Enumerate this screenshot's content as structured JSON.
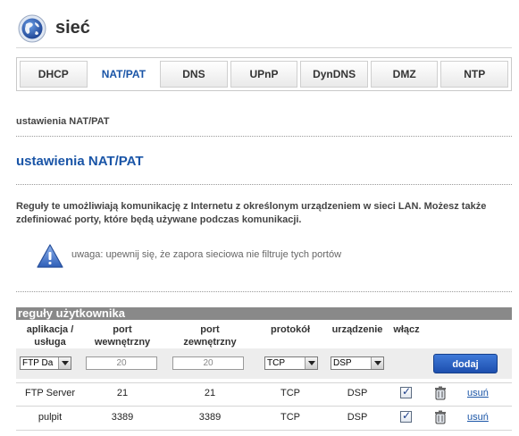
{
  "app": {
    "title": "sieć",
    "icon": "globe-icon"
  },
  "tabs": [
    {
      "label": "DHCP",
      "active": false
    },
    {
      "label": "NAT/PAT",
      "active": true
    },
    {
      "label": "DNS",
      "active": false
    },
    {
      "label": "UPnP",
      "active": false
    },
    {
      "label": "DynDNS",
      "active": false
    },
    {
      "label": "DMZ",
      "active": false
    },
    {
      "label": "NTP",
      "active": false
    }
  ],
  "breadcrumb": "ustawienia NAT/PAT",
  "page_title": "ustawienia NAT/PAT",
  "description": "Reguły te umożliwiają komunikację z Internetu z określonym urządzeniem w sieci LAN. Możesz także zdefiniować porty, które będą używane podczas komunikacji.",
  "warning": {
    "icon": "warning-icon",
    "text": "uwaga: upewnij się, że zapora sieciowa nie filtruje tych portów"
  },
  "rules": {
    "header": "reguły użytkownika",
    "columns": {
      "app_l1": "aplikacja /",
      "app_l2": "usługa",
      "int_l1": "port",
      "int_l2": "wewnętrzny",
      "ext_l1": "port",
      "ext_l2": "zewnętrzny",
      "protocol": "protokół",
      "device": "urządzenie",
      "enable": "włącz"
    },
    "form": {
      "app_value": "FTP Da",
      "int_port": "20",
      "ext_port": "20",
      "protocol_value": "TCP",
      "device_value": "DSP",
      "add_label": "dodaj"
    },
    "rows": [
      {
        "app": "FTP Server",
        "int": "21",
        "ext": "21",
        "protocol": "TCP",
        "device": "DSP",
        "enabled": true,
        "delete_label": "usuń"
      },
      {
        "app": "pulpit",
        "int": "3389",
        "ext": "3389",
        "protocol": "TCP",
        "device": "DSP",
        "enabled": true,
        "delete_label": "usuń"
      }
    ]
  },
  "colors": {
    "accent": "#1a55a7",
    "header_bar": "#898989",
    "button": "#2b62c4"
  }
}
